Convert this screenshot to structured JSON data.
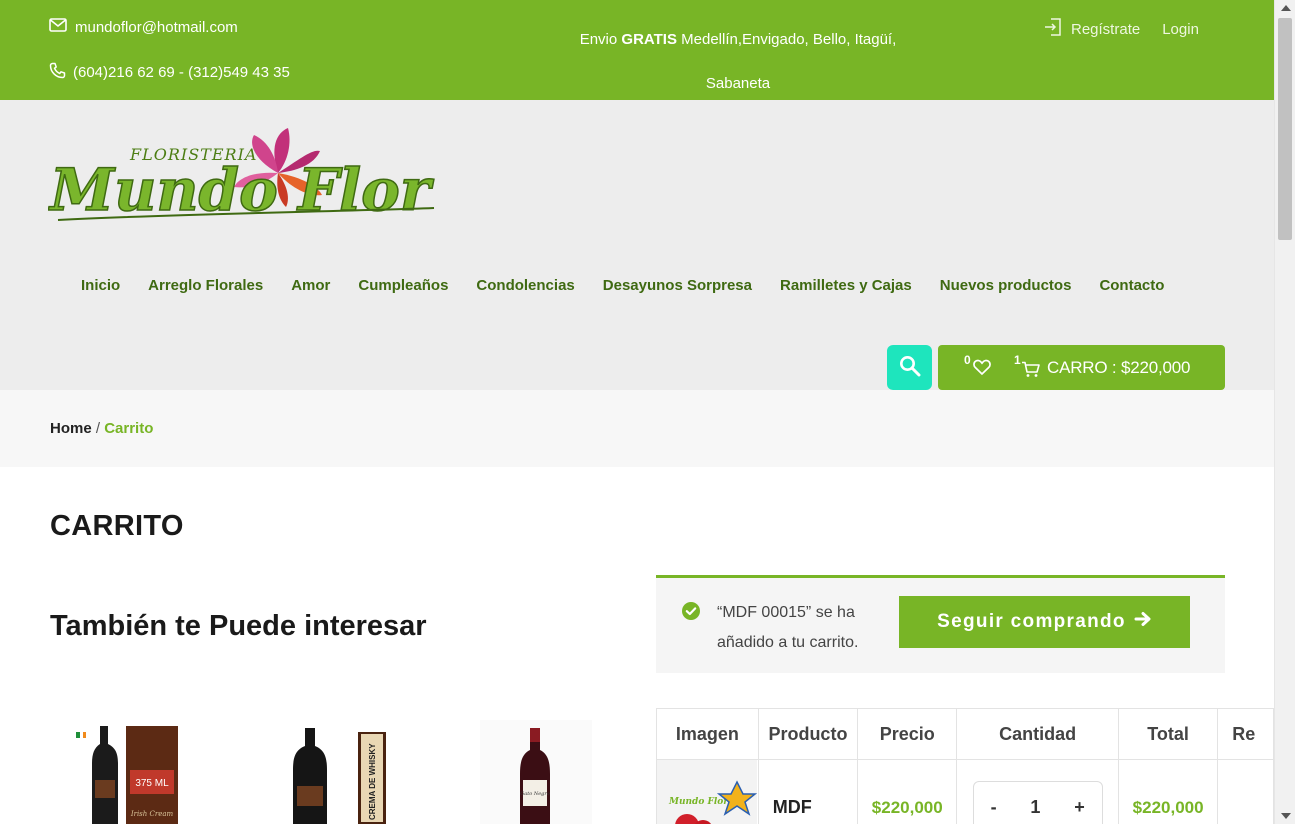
{
  "topbar": {
    "email": "mundoflor@hotmail.com",
    "phone": "(604)216 62 69 - (312)549 43 35",
    "shipping_prefix": "Envio ",
    "shipping_bold": "GRATIS",
    "shipping_rest": " Medellín,Envigado, Bello, Itagüí,",
    "shipping_line2": "Sabaneta",
    "register": "Regístrate",
    "login": "Login"
  },
  "logo": {
    "small_text": "FLORISTERIA",
    "main_text": "Mundo Flor"
  },
  "nav": {
    "items": [
      {
        "label": "Inicio"
      },
      {
        "label": "Arreglo Florales"
      },
      {
        "label": "Amor"
      },
      {
        "label": "Cumpleaños"
      },
      {
        "label": "Condolencias"
      },
      {
        "label": "Desayunos Sorpresa"
      },
      {
        "label": "Ramilletes y Cajas"
      },
      {
        "label": "Nuevos productos"
      },
      {
        "label": "Contacto"
      }
    ]
  },
  "cart": {
    "wishlist_count": "0",
    "cart_count": "1",
    "label": "CARRO : $220,000"
  },
  "breadcrumb": {
    "home": "Home",
    "separator": " / ",
    "current": "Carrito"
  },
  "page": {
    "title": "CARRITO",
    "related_title": "También te Puede interesar"
  },
  "related_products": [
    {
      "label": "375 ML",
      "note": "Irish Cream"
    },
    {
      "label": "CREMA DE WHISKY"
    },
    {
      "label": "Gato Negro"
    }
  ],
  "notice": {
    "message": "“MDF 00015” se ha añadido a tu carrito.",
    "button": "Seguir comprando"
  },
  "table": {
    "headers": [
      "Imagen",
      "Producto",
      "Precio",
      "Cantidad",
      "Total",
      "Re"
    ],
    "row": {
      "product": "MDF",
      "price": "$220,000",
      "quantity_minus": "-",
      "quantity": "1",
      "quantity_plus": "+",
      "total": "$220,000"
    }
  },
  "colors": {
    "brand_green": "#78b526",
    "nav_green": "#3f6a12",
    "search_teal": "#1ee5bd",
    "header_bg": "#ededed"
  }
}
